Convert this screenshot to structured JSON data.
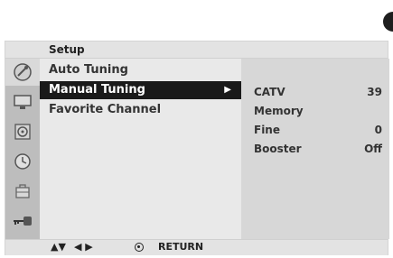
{
  "header": {
    "title": "Setup"
  },
  "sidebar": {
    "icons": [
      {
        "name": "setup-dish-icon",
        "active": true
      },
      {
        "name": "picture-monitor-icon"
      },
      {
        "name": "audio-speaker-icon"
      },
      {
        "name": "time-clock-icon"
      },
      {
        "name": "option-briefcase-icon"
      },
      {
        "name": "lock-key-icon"
      }
    ]
  },
  "menu": {
    "items": [
      {
        "label": "Auto Tuning"
      },
      {
        "label": "Manual Tuning",
        "selected": true,
        "arrow": "▶"
      },
      {
        "label": "Favorite Channel"
      }
    ]
  },
  "detail": {
    "rows": [
      {
        "key": "CATV",
        "value": "39"
      },
      {
        "key": "Memory",
        "value": ""
      },
      {
        "key": "Fine",
        "value": "0"
      },
      {
        "key": "Booster",
        "value": "Off"
      }
    ]
  },
  "footer": {
    "nav_updown": "▲▼",
    "nav_leftright": "◀ ▶",
    "return_label": "RETURN"
  }
}
